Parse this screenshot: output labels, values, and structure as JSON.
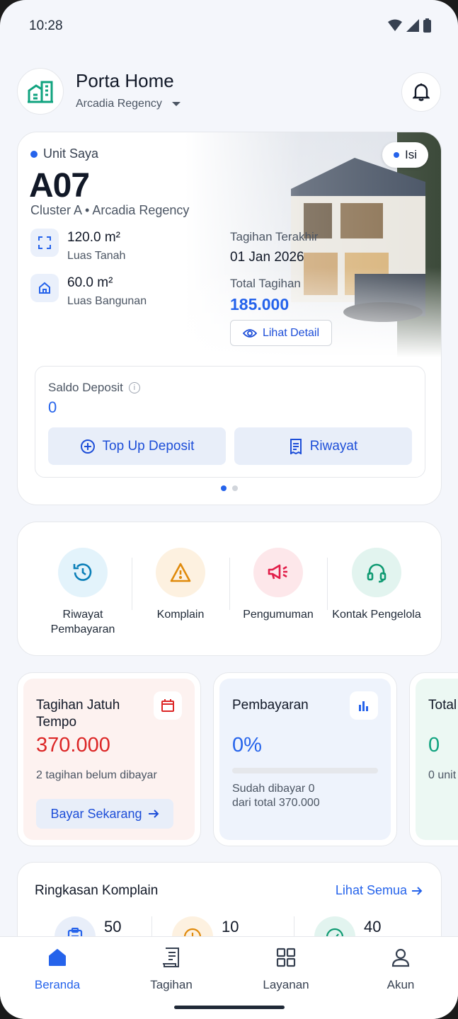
{
  "status_bar": {
    "time": "10:28"
  },
  "header": {
    "title": "Porta Home",
    "location": "Arcadia Regency"
  },
  "unit": {
    "label": "Unit Saya",
    "badge": "Isi",
    "code": "A07",
    "cluster": "Cluster A • Arcadia Regency",
    "land_area": "120.0 m²",
    "land_label": "Luas Tanah",
    "building_area": "60.0 m²",
    "building_label": "Luas Bangunan",
    "last_bill_label": "Tagihan Terakhir",
    "last_bill_date": "01 Jan 2026",
    "total_bill_label": "Total Tagihan",
    "total_bill_value": "185.000",
    "detail_label": "Lihat Detail",
    "deposit_label": "Saldo Deposit",
    "deposit_value": "0",
    "topup_label": "Top Up Deposit",
    "history_label": "Riwayat",
    "pager_count": 2,
    "pager_active": 0
  },
  "quick_actions": [
    {
      "label": "Riwayat Pembayaran",
      "icon": "history-icon",
      "bg": "#e3f3fb",
      "color": "#0b7fb8"
    },
    {
      "label": "Komplain",
      "icon": "warning-icon",
      "bg": "#fdf1e0",
      "color": "#e08a0b"
    },
    {
      "label": "Pengumuman",
      "icon": "megaphone-icon",
      "bg": "#fde7ea",
      "color": "#e11d48"
    },
    {
      "label": "Kontak Pengelola",
      "icon": "headset-icon",
      "bg": "#e2f4ef",
      "color": "#0f9a72"
    }
  ],
  "stats": {
    "due": {
      "title": "Tagihan Jatuh Tempo",
      "value": "370.000",
      "sub": "2 tagihan belum dibayar",
      "button": "Bayar Sekarang",
      "color": "#dc2626",
      "bg": "#fdf2f0"
    },
    "payment": {
      "title": "Pembayaran",
      "value": "0%",
      "progress": 0,
      "sub1": "Sudah dibayar 0",
      "sub2": "dari total 370.000",
      "color": "#2563eb",
      "bg": "#eef3fc"
    },
    "deposit": {
      "title": "Total Depo",
      "value": "0",
      "sub": "0 unit",
      "color": "#10a37f",
      "bg": "#ecf8f3"
    }
  },
  "complaints": {
    "title": "Ringkasan Komplain",
    "see_all": "Lihat Semua",
    "items": [
      {
        "value": "50",
        "icon": "clipboard-icon",
        "bg": "#e8eef9",
        "color": "#2563eb"
      },
      {
        "value": "10",
        "icon": "clock-icon",
        "bg": "#fdf1e0",
        "color": "#e08a0b"
      },
      {
        "value": "40",
        "icon": "check-circle-icon",
        "bg": "#e2f4ef",
        "color": "#0f9a72"
      }
    ]
  },
  "nav": [
    {
      "label": "Beranda",
      "icon": "home-icon"
    },
    {
      "label": "Tagihan",
      "icon": "receipt-icon"
    },
    {
      "label": "Layanan",
      "icon": "grid-icon"
    },
    {
      "label": "Akun",
      "icon": "user-icon"
    }
  ],
  "colors": {
    "accent": "#2563eb",
    "brand_green": "#10a37f"
  }
}
